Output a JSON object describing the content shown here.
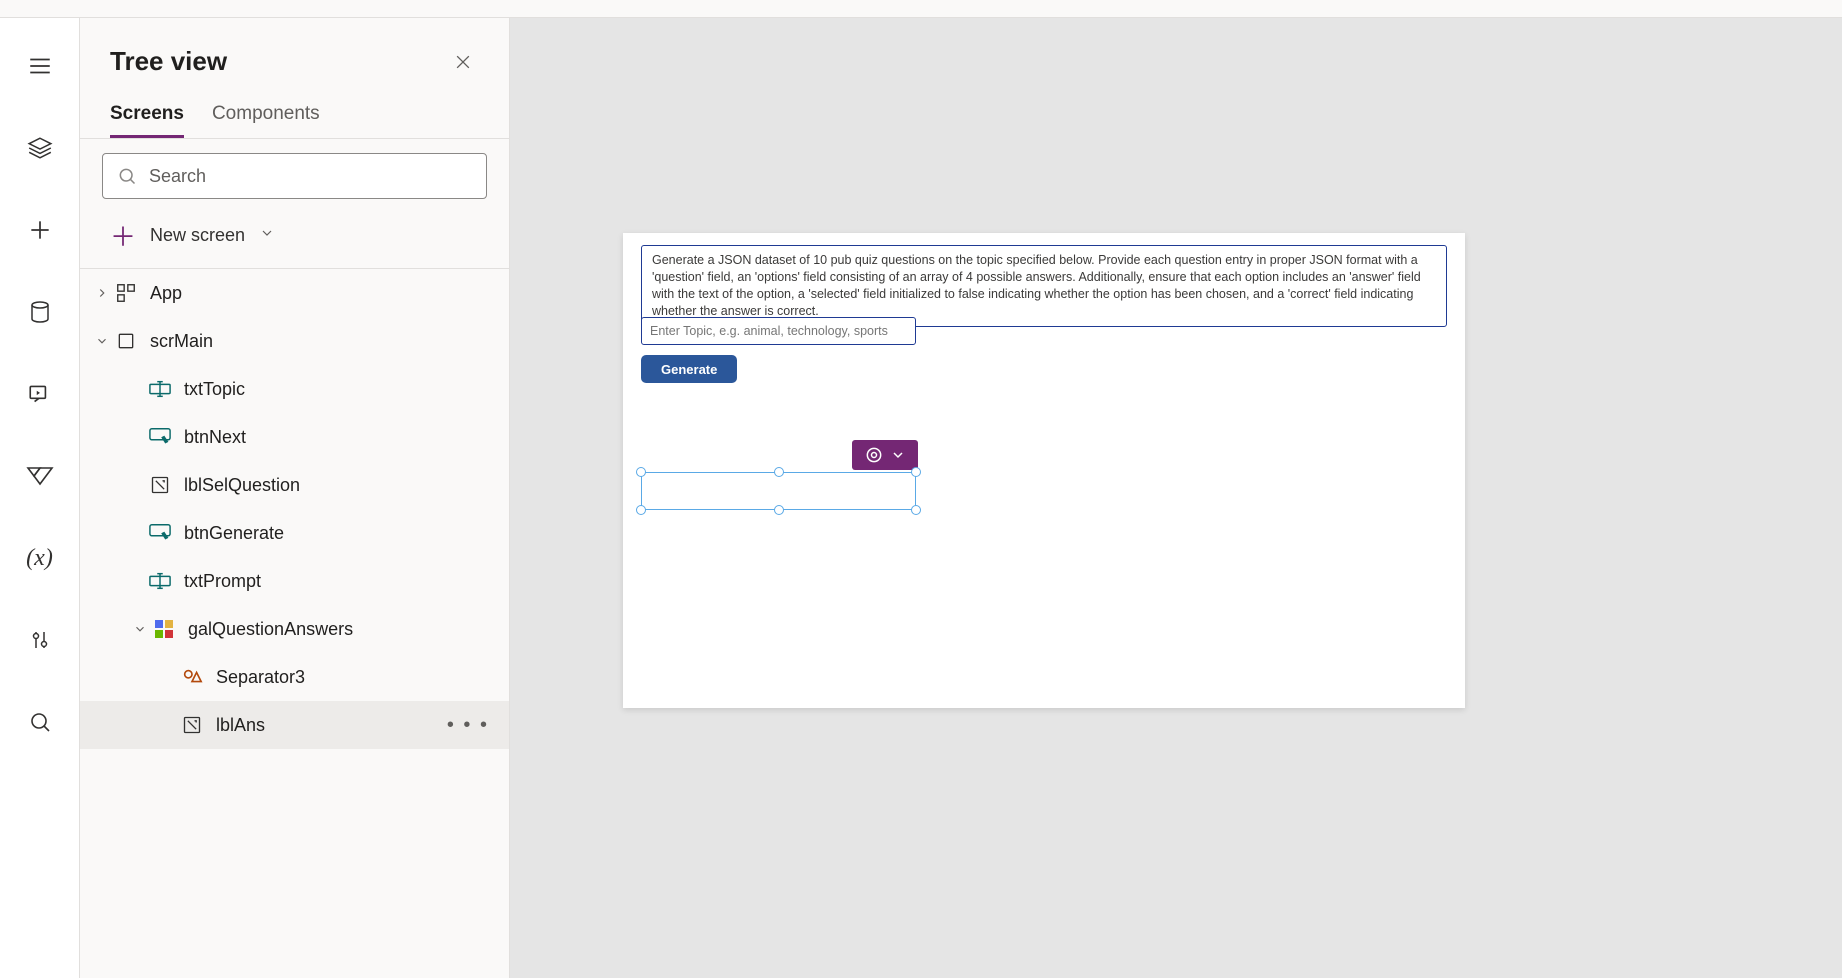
{
  "panel": {
    "title": "Tree view",
    "tabs": {
      "screens": "Screens",
      "components": "Components"
    },
    "search_placeholder": "Search",
    "new_screen": "New screen"
  },
  "tree": {
    "app": "App",
    "scrMain": "scrMain",
    "items": {
      "txtTopic": "txtTopic",
      "btnNext": "btnNext",
      "lblSelQuestion": "lblSelQuestion",
      "btnGenerate": "btnGenerate",
      "txtPrompt": "txtPrompt",
      "galQuestionAnswers": "galQuestionAnswers",
      "Separator3": "Separator3",
      "lblAns": "lblAns"
    }
  },
  "canvas": {
    "prompt_text": "Generate a JSON dataset of 10 pub quiz questions on the topic specified below. Provide each question entry in proper JSON format with a 'question' field, an 'options' field consisting of an array of 4 possible answers. Additionally, ensure that each option includes an 'answer' field with the text of the option, a 'selected' field initialized to false indicating whether the option has been chosen, and a 'correct' field indicating whether the answer is correct.",
    "topic_placeholder": "Enter Topic, e.g. animal, technology, sports",
    "generate_label": "Generate"
  }
}
